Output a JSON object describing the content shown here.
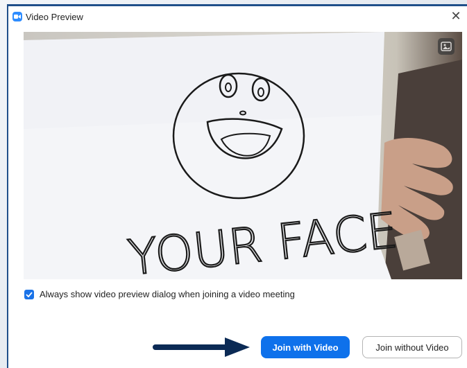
{
  "window": {
    "title": "Video Preview",
    "close_glyph": "✕"
  },
  "video": {
    "paper_text": "YOUR FACE",
    "toggle_icon": "image-toggle-icon"
  },
  "option": {
    "checked": true,
    "label": "Always show video preview dialog when joining a video meeting"
  },
  "buttons": {
    "join_with_video": "Join with Video",
    "join_without_video": "Join without Video"
  },
  "colors": {
    "accent": "#0e71eb",
    "frame": "#1f4f8a",
    "arrow": "#0b2a55"
  }
}
